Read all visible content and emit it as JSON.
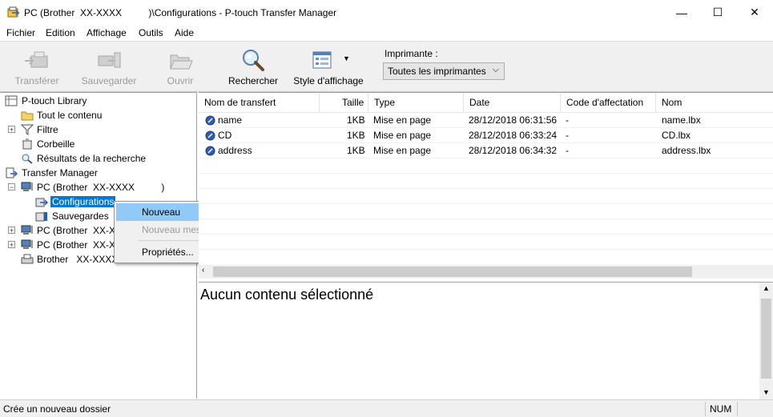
{
  "window": {
    "title": "PC (Brother  XX-XXXX          )\\Configurations - P-touch Transfer Manager",
    "minimize": "—",
    "maximize": "☐",
    "close": "✕"
  },
  "menu": [
    "Fichier",
    "Edition",
    "Affichage",
    "Outils",
    "Aide"
  ],
  "toolbar": {
    "transfer": "Transférer",
    "backup": "Sauvegarder",
    "open": "Ouvrir",
    "search": "Rechercher",
    "view_style": "Style d'affichage",
    "printer_label": "Imprimante :",
    "printer_value": "Toutes les imprimantes"
  },
  "tree": {
    "library": "P-touch Library",
    "all_content": "Tout le contenu",
    "filter": "Filtre",
    "trash": "Corbeille",
    "search_results": "Résultats de la recherche",
    "transfer_manager": "Transfer Manager",
    "pc1": "PC (Brother  XX-XXXX          )",
    "configurations": "Configurations",
    "backups": "Sauvegardes",
    "pc2": "PC (Brother  XX-XX",
    "pc3": "PC (Brother  XX-XX",
    "brother": "Brother   XX-XXXX"
  },
  "context_menu": {
    "new": "Nouveau",
    "new_message": "Nouveau message...",
    "properties": "Propriétés..."
  },
  "list": {
    "columns": [
      "Nom de transfert",
      "Taille",
      "Type",
      "Date",
      "Code d'affectation",
      "Nom"
    ],
    "rows": [
      {
        "name": "name",
        "size": "1KB",
        "type": "Mise en page",
        "date": "28/12/2018 06:31:56",
        "code": "-",
        "file": "name.lbx"
      },
      {
        "name": "CD",
        "size": "1KB",
        "type": "Mise en page",
        "date": "28/12/2018 06:33:24",
        "code": "-",
        "file": "CD.lbx"
      },
      {
        "name": "address",
        "size": "1KB",
        "type": "Mise en page",
        "date": "28/12/2018 06:34:32",
        "code": "-",
        "file": "address.lbx"
      }
    ]
  },
  "preview": {
    "empty_text": "Aucun contenu sélectionné"
  },
  "status": {
    "text": "Crée un nouveau dossier",
    "num": "NUM"
  },
  "colors": {
    "selection": "#0078d7",
    "highlight": "#91c9f7",
    "toolbar_bg": "#f0f0f0"
  }
}
